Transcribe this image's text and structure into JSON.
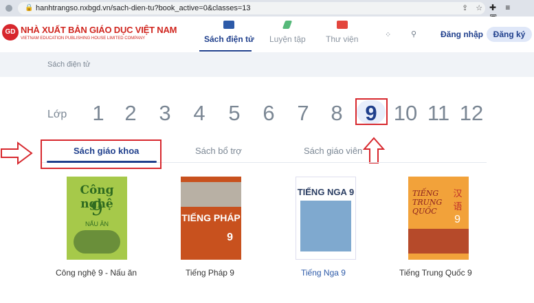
{
  "browser": {
    "url": "hanhtrangso.nxbgd.vn/sach-dien-tu?book_active=0&classes=13",
    "lock_icon": "lock-icon",
    "icons": [
      "share-icon",
      "star-icon",
      "extension-icon",
      "playlist-icon",
      "sidebar-icon"
    ]
  },
  "header": {
    "logo_mark": "GD",
    "logo_title": "NHÀ XUẤT BẢN GIÁO DỤC VIỆT NAM",
    "logo_sub": "VIETNAM EDUCATION PUBLISHING HOUSE LIMITED COMPANY",
    "nav": [
      {
        "label": "Sách điện tử",
        "icon": "book-icon",
        "active": true
      },
      {
        "label": "Luyện tập",
        "icon": "pencil-icon",
        "active": false
      },
      {
        "label": "Thư viện",
        "icon": "chat-icon",
        "active": false
      }
    ],
    "login": "Đăng nhập",
    "register": "Đăng ký"
  },
  "breadcrumb": "Sách điện tử",
  "grades": {
    "label": "Lớp",
    "items": [
      "1",
      "2",
      "3",
      "4",
      "5",
      "6",
      "7",
      "8",
      "9",
      "10",
      "11",
      "12"
    ],
    "selected": "9"
  },
  "tabs": [
    {
      "label": "Sách giáo khoa",
      "active": true
    },
    {
      "label": "Sách bổ trợ",
      "active": false
    },
    {
      "label": "Sách giáo viên",
      "active": false
    }
  ],
  "books": [
    {
      "title": "Công nghệ 9 - Nấu ăn",
      "cover_title": "Công nghệ",
      "cover_grade": "9",
      "cover_sub": "NẤU ĂN",
      "color": "#a6c94a"
    },
    {
      "title": "Tiếng Pháp 9",
      "cover_title": "TIẾNG PHÁP",
      "cover_grade": "9",
      "color": "#c8511e"
    },
    {
      "title": "Tiếng Nga 9",
      "cover_title": "TIẾNG NGA 9",
      "color": "#7fa9cf"
    },
    {
      "title": "Tiếng Trung Quốc 9",
      "cover_title": "TIẾNG TRUNG QUỐC",
      "cover_grade": "9",
      "cover_chinese": "汉语",
      "color": "#f2a23a"
    }
  ],
  "colors": {
    "brand_red": "#d7272d",
    "accent_blue": "#1f3f8c",
    "highlight": "#e8eefb"
  }
}
